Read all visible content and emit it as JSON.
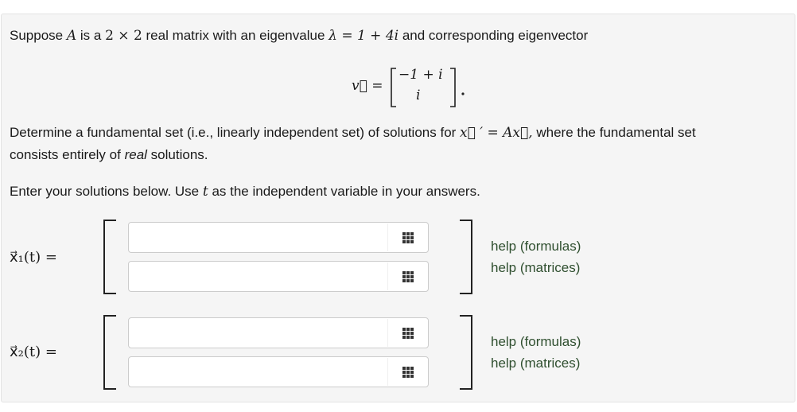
{
  "problem": {
    "line1_prefix": "Suppose",
    "line1_A": "A",
    "line1_mid1": "is a",
    "line1_dim": "2 × 2",
    "line1_mid2": "real matrix with an eigenvalue",
    "line1_lambda": "λ = 1 + 4i",
    "line1_suffix": "and corresponding eigenvector",
    "vector_label": "v⃗ =",
    "vector_top": "−1 + i",
    "vector_bottom": "i",
    "line2_prefix": "Determine a fundamental set (i.e., linearly independent set) of solutions for",
    "line2_eq": "x⃗ ′ = Ax⃗,",
    "line2_suffix": "where the fundamental set",
    "line3_prefix": "consists entirely of",
    "line3_em": "real",
    "line3_suffix": "solutions.",
    "line4_prefix": "Enter your solutions below. Use",
    "line4_t": "t",
    "line4_suffix": "as the independent variable in your answers."
  },
  "answers": [
    {
      "label": "x⃗₁(t) =",
      "fields": [
        {
          "value": "",
          "icon": "matrix-grid-icon"
        },
        {
          "value": "",
          "icon": "matrix-grid-icon"
        }
      ],
      "help_formulas": "help (formulas)",
      "help_matrices": "help (matrices)"
    },
    {
      "label": "x⃗₂(t) =",
      "fields": [
        {
          "value": "",
          "icon": "matrix-grid-icon"
        },
        {
          "value": "",
          "icon": "matrix-grid-icon"
        }
      ],
      "help_formulas": "help (formulas)",
      "help_matrices": "help (matrices)"
    }
  ],
  "colors": {
    "panel_bg": "#f5f5f5",
    "help_link": "#2f4f2f"
  }
}
